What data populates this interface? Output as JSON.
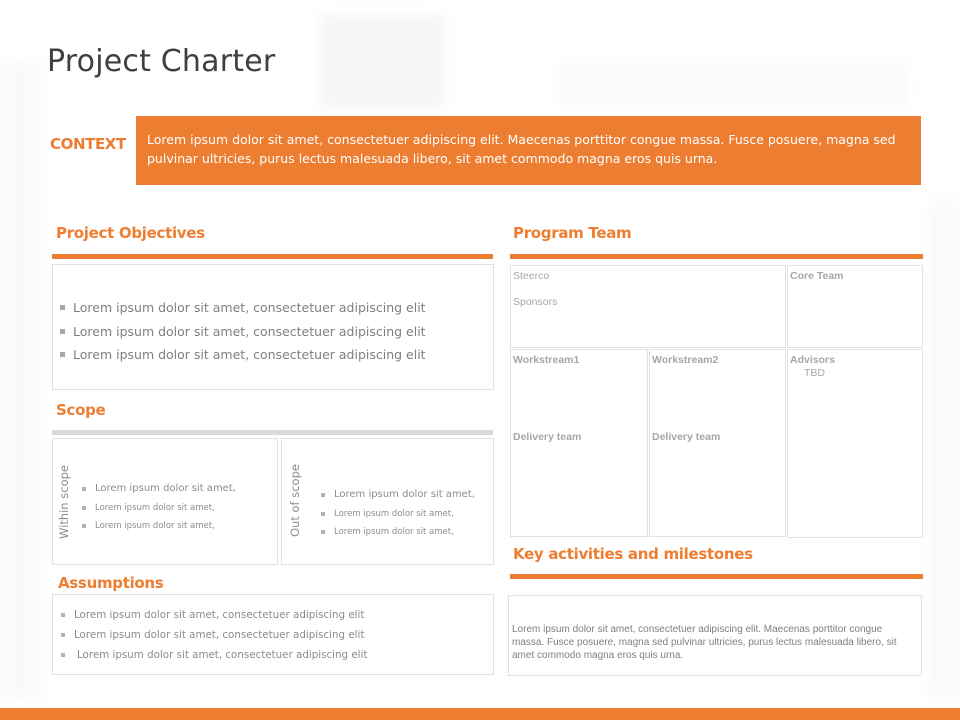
{
  "slide": {
    "title": "Project Charter",
    "accent_color": "#ed7d31"
  },
  "context": {
    "label": "CONTEXT",
    "text": "Lorem ipsum dolor sit amet, consectetuer adipiscing elit. Maecenas porttitor congue massa. Fusce posuere, magna sed pulvinar ultricies, purus lectus malesuada libero, sit amet commodo magna eros quis urna."
  },
  "objectives": {
    "title": "Project Objectives",
    "items": [
      "Lorem ipsum dolor sit amet, consectetuer adipiscing elit",
      "Lorem ipsum dolor sit amet, consectetuer adipiscing elit",
      "Lorem ipsum dolor sit amet, consectetuer adipiscing elit"
    ]
  },
  "scope": {
    "title": "Scope",
    "within": {
      "label": "Within scope",
      "items": [
        "Lorem ipsum dolor sit amet,",
        "Lorem ipsum dolor sit amet,",
        "Lorem ipsum dolor sit amet,"
      ]
    },
    "out": {
      "label": "Out of scope",
      "items": [
        "Lorem ipsum dolor sit amet,",
        "Lorem ipsum dolor sit amet,",
        "Lorem ipsum dolor sit amet,"
      ]
    }
  },
  "assumptions": {
    "title": "Assumptions",
    "items": [
      "Lorem  ipsum dolor sit amet, consectetuer  adipiscing elit",
      "Lorem  ipsum dolor sit amet, consectetuer  adipiscing elit",
      "Lorem  ipsum dolor sit amet, consectetuer  adipiscing elit"
    ]
  },
  "program_team": {
    "title": "Program Team",
    "steerco": "Steerco",
    "sponsors": "Sponsors",
    "core_team": "Core Team",
    "workstream1": {
      "label": "Workstream1",
      "delivery": "Delivery team"
    },
    "workstream2": {
      "label": "Workstream2",
      "delivery": "Delivery team"
    },
    "advisors": {
      "label": "Advisors",
      "value": "TBD"
    }
  },
  "milestones": {
    "title": "Key activities and milestones",
    "text": "Lorem ipsum dolor sit amet,  consectetuer adipiscing elit. Maecenas porttitor congue massa. Fusce posuere, magna sed pulvinar ultricies, purus lectus malesuada libero, sit amet commodo magna eros quis urna."
  }
}
